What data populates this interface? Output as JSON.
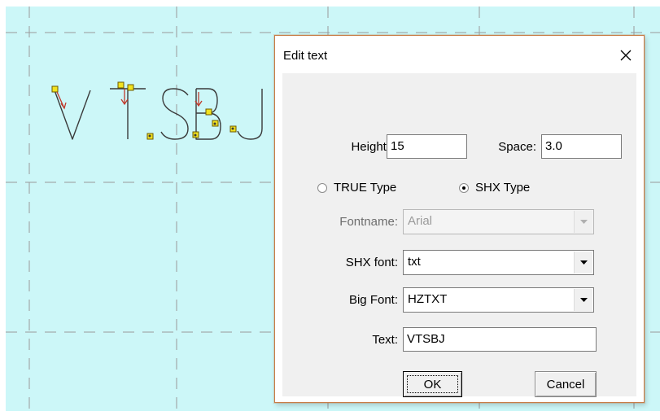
{
  "canvas": {
    "background": "#ccf7f8",
    "grid_color": "#9a9a9a",
    "drawing_text": "VTSBJ",
    "marker_fill": "#f1e21f",
    "marker_arrow_color": "#c0392b",
    "stroke_color": "#3a3a3a"
  },
  "dialog": {
    "title": "Edit text",
    "close_icon": "close-icon",
    "height_label": "Height:",
    "height_value": "15",
    "space_label": "Space:",
    "space_value": "3.0",
    "type_options": [
      {
        "label": "TRUE Type",
        "selected": false
      },
      {
        "label": "SHX Type",
        "selected": true
      }
    ],
    "fontname_label": "Fontname:",
    "fontname_value": "Arial",
    "fontname_enabled": false,
    "shx_font_label": "SHX font:",
    "shx_font_value": "txt",
    "big_font_label": "Big Font:",
    "big_font_value": "HZTXT",
    "text_label": "Text:",
    "text_value": "VTSBJ",
    "ok_label": "OK",
    "cancel_label": "Cancel",
    "border_color": "#c77b45"
  }
}
